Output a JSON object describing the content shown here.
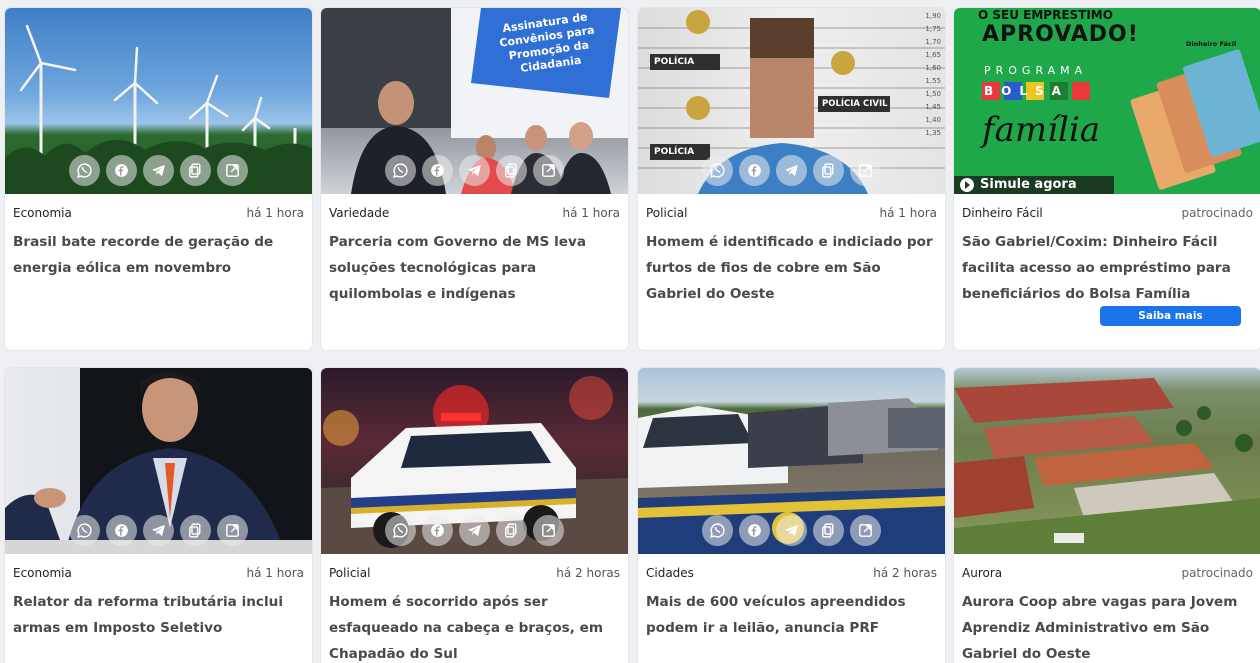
{
  "share_icons": [
    "whatsapp-icon",
    "facebook-icon",
    "telegram-icon",
    "copy-icon",
    "external-link-icon"
  ],
  "cards": [
    {
      "category": "Economia",
      "time": "há 1 hora",
      "title": "Brasil bate recorde de geração de energia eólica em novembro",
      "image": "wind-turbines"
    },
    {
      "category": "Variedade",
      "time": "há 1 hora",
      "title": "Parceria com Governo de MS leva soluções tecnológicas para quilombolas e indígenas",
      "image": "event-photo",
      "banner_text": "Assinatura de Convênios para Promoção da Cidadania"
    },
    {
      "category": "Policial",
      "time": "há 1 hora",
      "title": "Homem é identificado e indiciado por furtos de fios de cobre em São Gabriel do Oeste",
      "image": "police-mugshot",
      "badge_text": "POLÍCIA CIVIL",
      "badge_short": "POLÍCIA",
      "heights": [
        "1,90",
        "1,75",
        "1,70",
        "1,65",
        "1,60",
        "1,55",
        "1,50",
        "1,45",
        "1,40",
        "1,35"
      ]
    },
    {
      "category": "Dinheiro Fácil",
      "time": "patrocinado",
      "title": "São Gabriel/Coxim: Dinheiro Fácil facilita acesso ao empréstimo para beneficiários do Bolsa Família",
      "cta": "Saiba mais",
      "image": "ad-bolsa-familia",
      "ad": {
        "line1": "O SEU EMPRESTIMO",
        "line2": "APROVADO!",
        "brand": "Dinheiro Fácil",
        "program": "PROGRAMA",
        "bolsa": "BOLSA",
        "familia": "família",
        "cta": "Simule agora"
      }
    },
    {
      "category": "Economia",
      "time": "há 1 hora",
      "title": "Relator da reforma tributária inclui armas em Imposto Seletivo",
      "image": "man-at-microphone"
    },
    {
      "category": "Policial",
      "time": "há 2 horas",
      "title": "Homem é socorrido após ser esfaqueado na cabeça e braços, em Chapadão do Sul",
      "image": "police-car-night"
    },
    {
      "category": "Cidades",
      "time": "há 2 horas",
      "title": "Mais de 600 veículos apreendidos podem ir a leilão, anuncia PRF",
      "image": "seized-cars"
    },
    {
      "category": "Aurora",
      "time": "patrocinado",
      "title": "Aurora Coop abre vagas para Jovem Aprendiz Administrativo em São Gabriel do Oeste",
      "image": "aerial-industrial"
    }
  ]
}
